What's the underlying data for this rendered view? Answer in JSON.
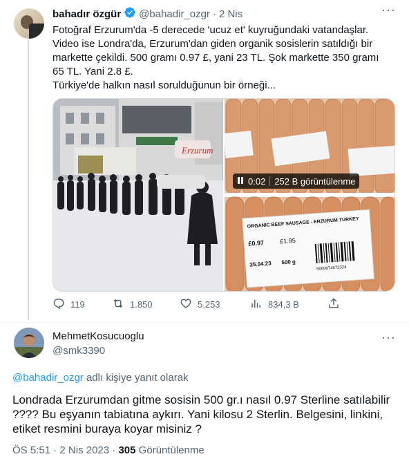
{
  "tweet": {
    "author_name": "bahadır özgür",
    "author_handle": "@bahadir_ozgr",
    "separator": "·",
    "time": "2 Nis",
    "text_lines": [
      "Fotoğraf Erzurum'da -5 derecede 'ucuz et' kuyruğundaki vatandaşlar.",
      "Video ise Londra'da, Erzurum'dan giden organik sosislerin satıldığı bir",
      "markette çekildi. 500 gramı 0.97 £, yani 23 TL. Şok markette 350 gramı",
      "65 TL. Yani 2.8 £.",
      "Türkiye'de halkın nasıl sorulduğunun bir örneği..."
    ],
    "video_time": "0:02",
    "video_views": "252 B görüntülenme",
    "store_sign": "Erzurum",
    "label_title": "ORGANIC BEEF SAUSAGE - ERZURUM TURKEY",
    "label_price": "£0.97",
    "label_weight": "500 g",
    "label_date": "25.04.23",
    "label_barcode": "5060074672324",
    "label_price2": "£1.95",
    "stats": {
      "replies": "119",
      "retweets": "1.850",
      "likes": "5.253",
      "views": "834,3 B"
    }
  },
  "reply": {
    "author_name": "MehmetKosucuoglu",
    "author_handle": "@smk3390",
    "replying_to_handle": "@bahadir_ozgr",
    "replying_to_suffix": " adlı kişiye yanıt olarak",
    "text_lines": [
      "Londrada Erzurumdan gitme sosisin 500 gr.ı nasıl 0.97 Sterline satılabilir",
      "???? Bu eşyanın tabiatına aykırı. Yani kilosu 2 Sterlin. Belgesini, linkini,",
      "etiket resmini buraya koyar misiniz ?"
    ],
    "time": "ÖS 5:51",
    "date": "2 Nis 2023",
    "views_count": "305",
    "views_label": "Görüntülenme"
  },
  "colors": {
    "text": "#0f1419",
    "muted": "#536471",
    "link": "#1d9bf0",
    "verified": "#1d9bf0"
  }
}
